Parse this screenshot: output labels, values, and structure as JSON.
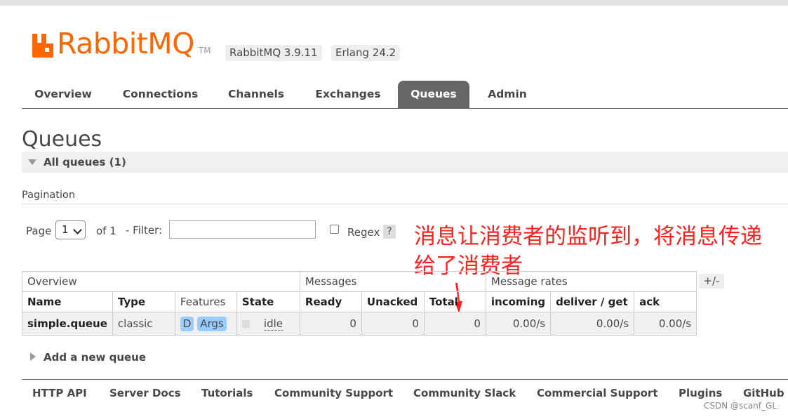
{
  "header": {
    "logo_text": "RabbitMQ",
    "logo_tm": "TM",
    "version_badge": "RabbitMQ 3.9.11",
    "erlang_badge": "Erlang 24.2",
    "brand_color": "#ff6600"
  },
  "nav": {
    "tabs": [
      "Overview",
      "Connections",
      "Channels",
      "Exchanges",
      "Queues",
      "Admin"
    ],
    "active": "Queues"
  },
  "page": {
    "title": "Queues",
    "section_label": "All queues (1)"
  },
  "pagination": {
    "label": "Pagination",
    "page_label": "Page",
    "page_value": "1",
    "of_label": "of 1",
    "filter_label": "- Filter:",
    "filter_value": "",
    "regex_label": "Regex",
    "regex_checked": false,
    "help": "?"
  },
  "annotation": {
    "text": "消息让消费者的监听到，将消息传递给了消费者",
    "color": "#ff2020"
  },
  "table": {
    "groups": [
      "Overview",
      "Messages",
      "Message rates"
    ],
    "toggle": "+/-",
    "columns": [
      "Name",
      "Type",
      "Features",
      "State",
      "Ready",
      "Unacked",
      "Total",
      "incoming",
      "deliver / get",
      "ack"
    ],
    "rows": [
      {
        "name": "simple.queue",
        "type": "classic",
        "features": [
          "D",
          "Args"
        ],
        "state": "idle",
        "ready": "0",
        "unacked": "0",
        "total": "0",
        "incoming": "0.00/s",
        "deliver_get": "0.00/s",
        "ack": "0.00/s"
      }
    ]
  },
  "add_queue": {
    "label": "Add a new queue"
  },
  "footer": {
    "links": [
      "HTTP API",
      "Server Docs",
      "Tutorials",
      "Community Support",
      "Community Slack",
      "Commercial Support",
      "Plugins",
      "GitHub"
    ],
    "watermark": "CSDN @scanf_GL"
  }
}
